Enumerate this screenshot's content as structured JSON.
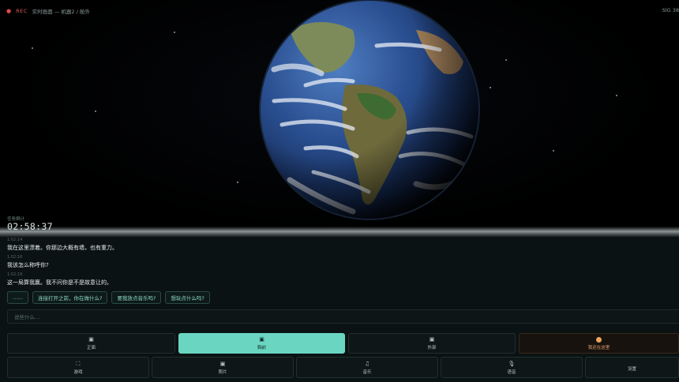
{
  "topbar": {
    "rec_icon": "●",
    "rec": "REC",
    "title": "实时画面 — 机器2 / 舱外",
    "signal": "SIG 38"
  },
  "timer": {
    "label": "任务倒计",
    "value": "02:58:37"
  },
  "messages": [
    {
      "time": "1:02:14",
      "text": "我在这里漂着。你那边大概有墙，也有重力。"
    },
    {
      "time": "1:02:16",
      "text": "我该怎么称呼你?"
    },
    {
      "time": "1:02:19",
      "text": "这一局算我赢。我不问你是不是故意让的。"
    }
  ],
  "chips": [
    "……",
    "连接打开之前，你在做什么?",
    "要我放点音乐吗?",
    "想玩点什么吗?"
  ],
  "input": {
    "placeholder": "说些什么…"
  },
  "row1": [
    {
      "icon": "▣",
      "label": "正面",
      "state": "normal"
    },
    {
      "icon": "▣",
      "label": "胸前",
      "state": "active"
    },
    {
      "icon": "▣",
      "label": "外部",
      "state": "normal"
    },
    {
      "icon": "orange-dot",
      "label": "我还在这里",
      "state": "warn"
    }
  ],
  "row2": [
    {
      "icon": "⛶",
      "label": "游戏"
    },
    {
      "icon": "▣",
      "label": "照片"
    },
    {
      "icon": "♫",
      "label": "音乐"
    },
    {
      "icon": "🎙",
      "label": "语音"
    },
    {
      "icon": "",
      "label": "设置"
    }
  ],
  "colors": {
    "accent": "#6ad6c2",
    "warn": "#e9a45e",
    "rec": "#e04a4a"
  }
}
